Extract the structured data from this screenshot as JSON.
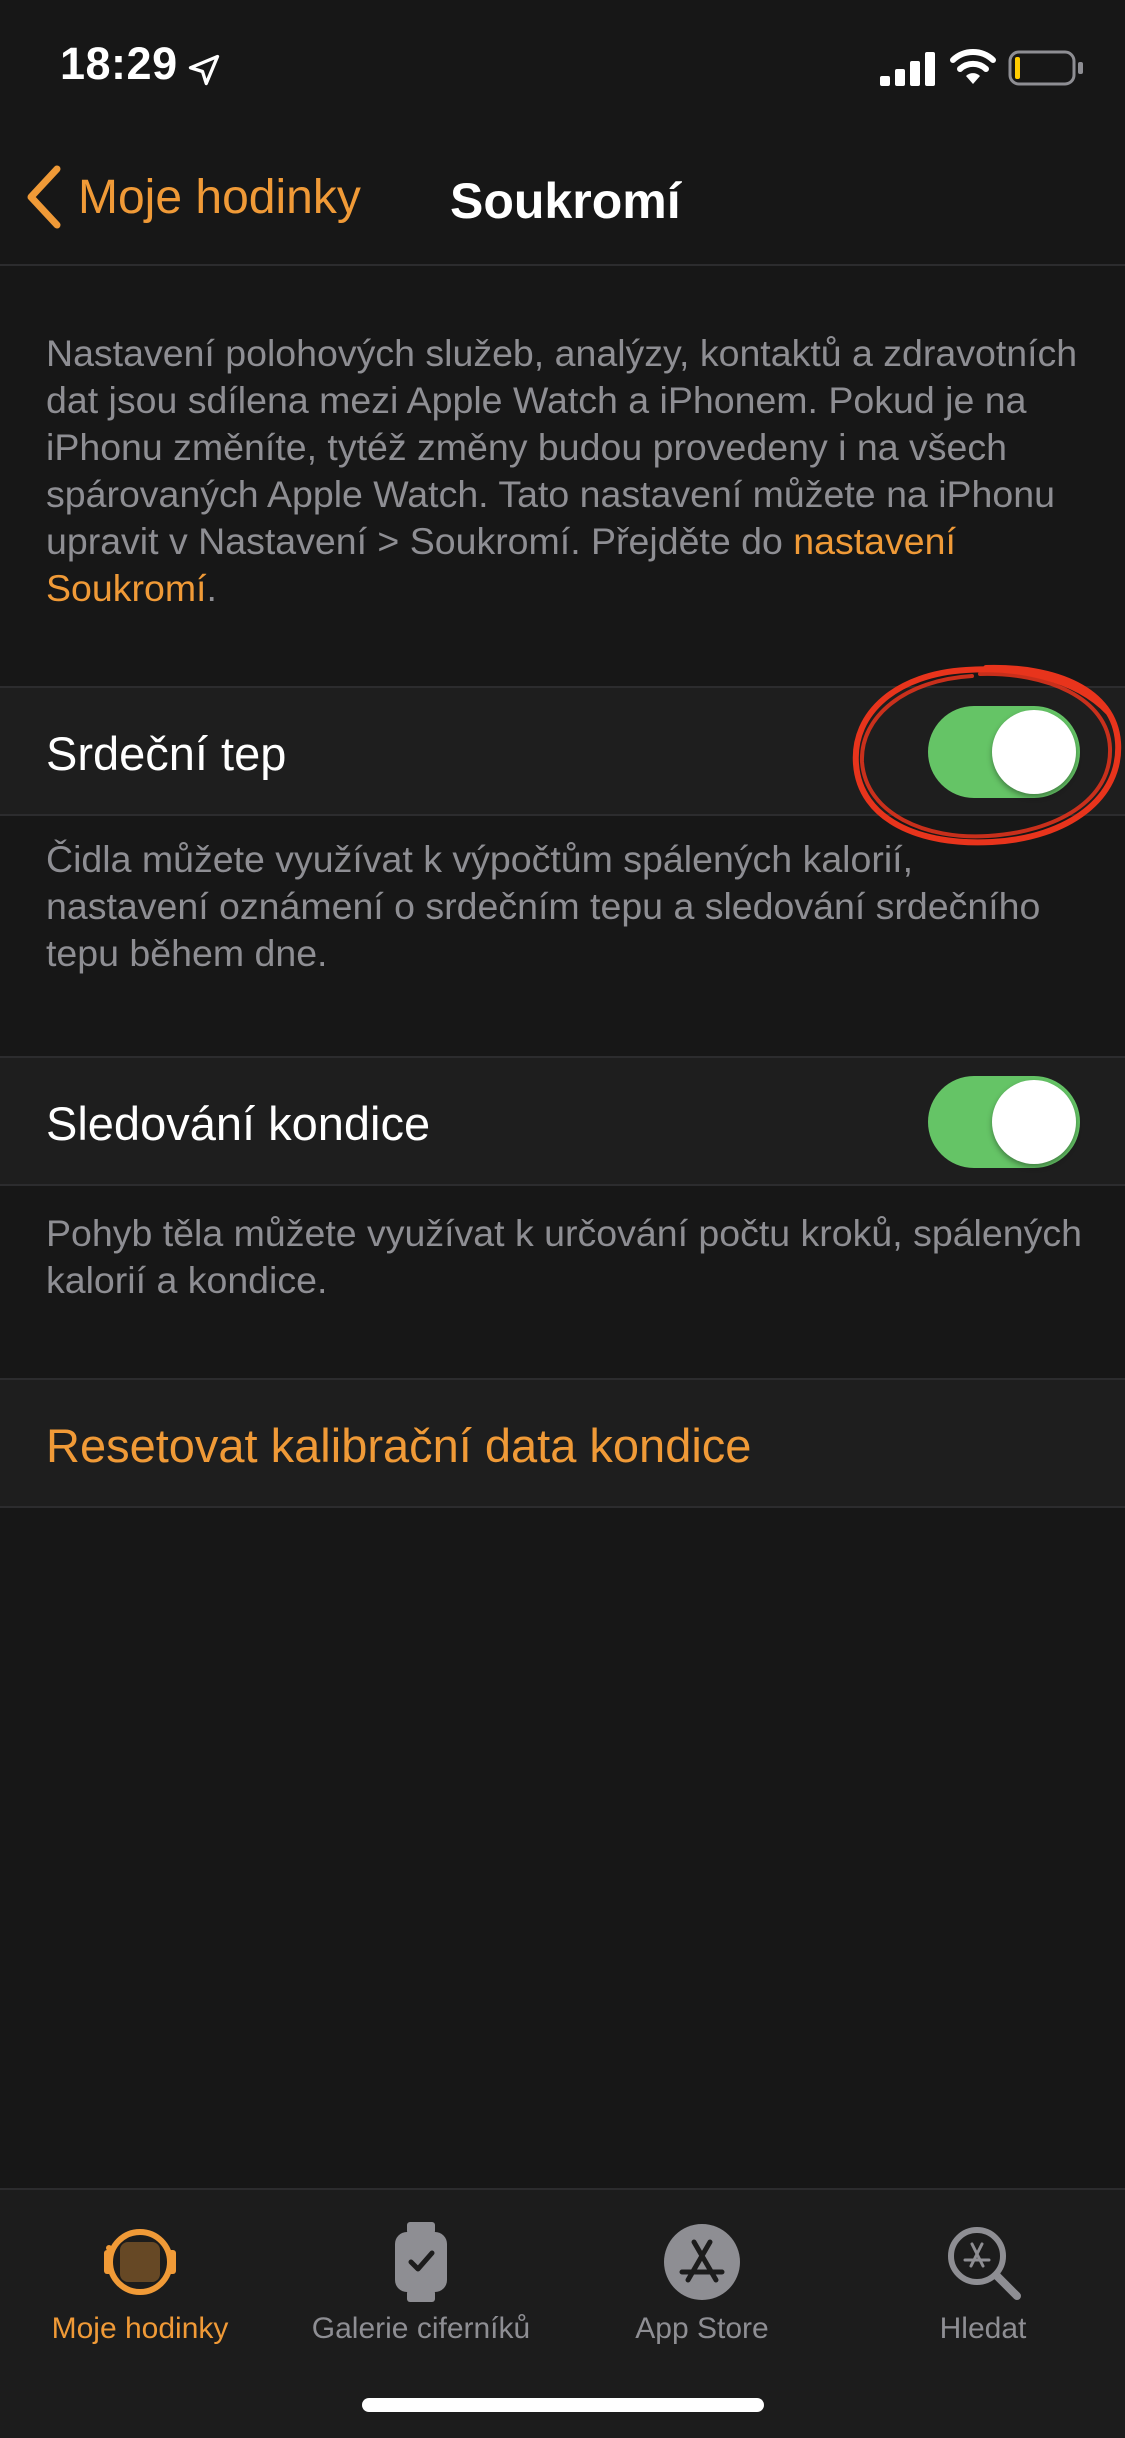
{
  "status_bar": {
    "time": "18:29",
    "icons": [
      "location-arrow-icon",
      "cellular-signal-icon",
      "wifi-icon",
      "battery-icon"
    ]
  },
  "nav": {
    "back_label": "Moje hodinky",
    "title": "Soukromí"
  },
  "intro": {
    "text": "Nastavení polohových služeb, analýzy, kontaktů a zdravotních dat jsou sdílena mezi Apple Watch a iPhonem. Pokud je na iPhonu změníte, tytéž změny budou provedeny i na všech spárovaných Apple Watch. Tato nastavení můžete na iPhonu upravit v Nastavení > Soukromí. Přejděte do ",
    "link": "nastavení Soukromí",
    "suffix": "."
  },
  "settings": {
    "heart_rate": {
      "label": "Srdeční tep",
      "enabled": true,
      "footer": "Čidla můžete využívat k výpočtům spálených kalorií, nastavení oznámení o srdečním tepu a sledování srdečního tepu během dne."
    },
    "fitness_tracking": {
      "label": "Sledování kondice",
      "enabled": true,
      "footer": "Pohyb těla můžete využívat k určování počtu kroků, spálených kalorií a kondice."
    },
    "reset": {
      "label": "Resetovat kalibrační data kondice"
    }
  },
  "tabs": [
    {
      "label": "Moje hodinky",
      "icon": "watch-icon",
      "active": true
    },
    {
      "label": "Galerie ciferníků",
      "icon": "watch-face-gallery-icon",
      "active": false
    },
    {
      "label": "App Store",
      "icon": "app-store-icon",
      "active": false
    },
    {
      "label": "Hledat",
      "icon": "search-icon",
      "active": false
    }
  ],
  "colors": {
    "accent": "#f09a37",
    "toggle_on": "#65c466",
    "background": "#171717",
    "secondary_text": "#8e8e93",
    "annotation": "#e8341c"
  }
}
